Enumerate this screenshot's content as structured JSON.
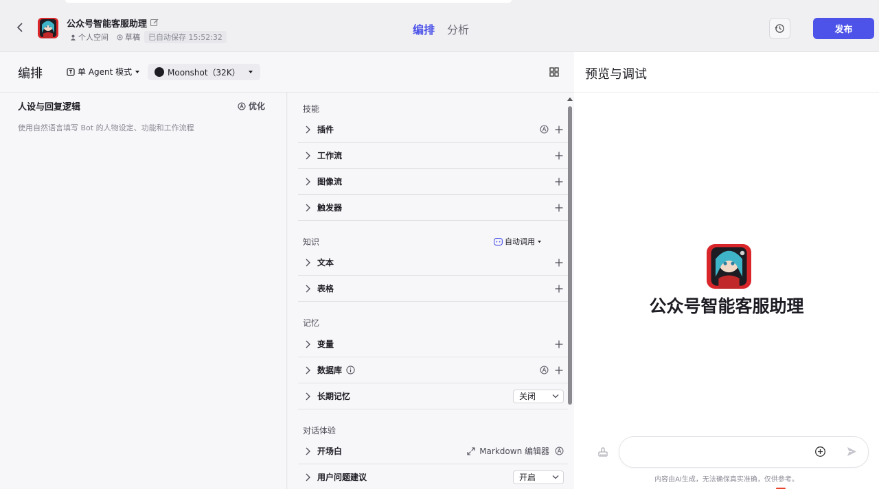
{
  "header": {
    "bot_name": "公众号智能客服助理",
    "workspace": "个人空间",
    "status": "草稿",
    "saved": "已自动保存 15:52:32",
    "tabs": [
      {
        "label": "编排",
        "active": true
      },
      {
        "label": "分析",
        "active": false
      }
    ],
    "publish_label": "发布"
  },
  "toolbar": {
    "title": "编排",
    "mode": "单 Agent 模式",
    "model": "Moonshot（32K）"
  },
  "persona": {
    "title": "人设与回复逻辑",
    "optimize_label": "优化",
    "placeholder": "使用自然语言填写 Bot 的人物设定、功能和工作流程"
  },
  "skills": {
    "label": "技能",
    "items": [
      {
        "label": "插件"
      },
      {
        "label": "工作流"
      },
      {
        "label": "图像流"
      },
      {
        "label": "触发器"
      }
    ]
  },
  "knowledge": {
    "label": "知识",
    "auto_call": "自动调用",
    "items": [
      {
        "label": "文本"
      },
      {
        "label": "表格"
      }
    ]
  },
  "memory": {
    "label": "记忆",
    "items": [
      {
        "label": "变量"
      },
      {
        "label": "数据库"
      },
      {
        "label": "长期记忆",
        "value": "关闭"
      }
    ]
  },
  "dialog": {
    "label": "对话体验",
    "items": [
      {
        "label": "开场白",
        "link": "Markdown 编辑器"
      },
      {
        "label": "用户问题建议",
        "value": "开启"
      }
    ]
  },
  "preview": {
    "title": "预览与调试",
    "bot_name": "公众号智能客服助理",
    "input_placeholder": "",
    "disclaimer": "内容由AI生成，无法确保真实准确，仅供参考。"
  },
  "colors": {
    "accent": "#4d53e8",
    "background": "#f2f2f5",
    "panel": "#f7f7f9"
  }
}
